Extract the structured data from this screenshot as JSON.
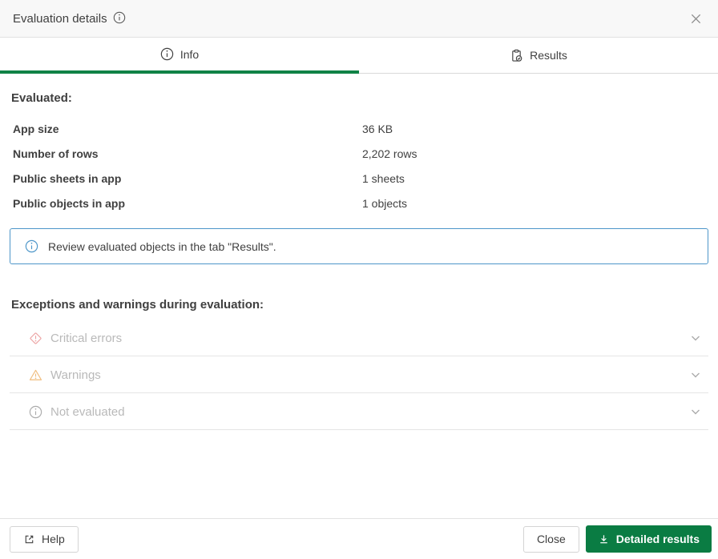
{
  "dialog": {
    "title": "Evaluation details"
  },
  "tabs": [
    {
      "label": "Info",
      "icon": "info-circle-icon",
      "active": true
    },
    {
      "label": "Results",
      "icon": "clipboard-check-icon",
      "active": false
    }
  ],
  "evaluated": {
    "heading": "Evaluated:",
    "rows": [
      {
        "label": "App size",
        "value": "36 KB"
      },
      {
        "label": "Number of rows",
        "value": "2,202 rows"
      },
      {
        "label": "Public sheets in app",
        "value": "1 sheets"
      },
      {
        "label": "Public objects in app",
        "value": "1 objects"
      }
    ]
  },
  "banner": {
    "icon": "info-circle-icon",
    "text": "Review evaluated objects in the tab \"Results\"."
  },
  "exceptions": {
    "heading": "Exceptions and warnings during evaluation:",
    "sections": [
      {
        "label": "Critical errors",
        "icon": "critical-diamond-icon",
        "state": "collapsed"
      },
      {
        "label": "Warnings",
        "icon": "warning-triangle-icon",
        "state": "collapsed"
      },
      {
        "label": "Not evaluated",
        "icon": "info-circle-icon",
        "state": "collapsed"
      }
    ]
  },
  "footer": {
    "help_label": "Help",
    "close_label": "Close",
    "detailed_results_label": "Detailed results"
  },
  "colors": {
    "tab_active_green": "#108246",
    "primary_button_green": "#0a7c43",
    "info_banner_blue": "#4d96c9",
    "disabled_text_gray": "#b9b9b9",
    "critical_icon_red": "#eca4a4",
    "warning_icon_orange": "#f0bd7f",
    "header_background": "#f8f8f8"
  }
}
